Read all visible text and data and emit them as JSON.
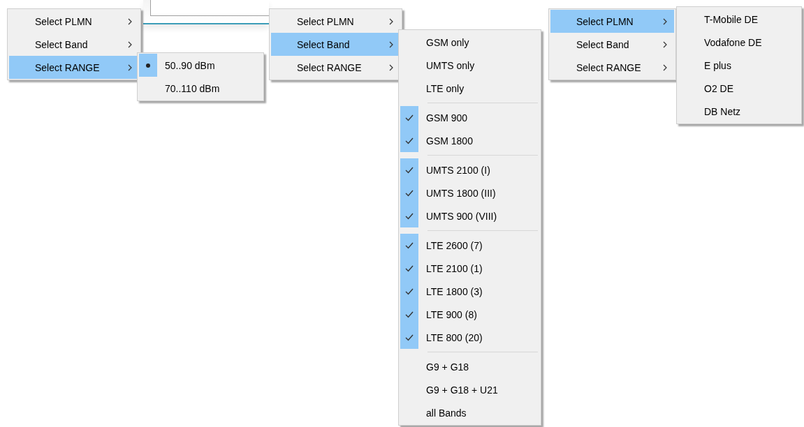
{
  "menus": [
    {
      "items": [
        {
          "label": "Select PLMN",
          "selected": false
        },
        {
          "label": "Select Band",
          "selected": false
        },
        {
          "label": "Select RANGE",
          "selected": true
        }
      ],
      "submenu": {
        "items": [
          {
            "kind": "radio",
            "label": "50..90 dBm",
            "checked": true
          },
          {
            "kind": "radio",
            "label": "70..110 dBm",
            "checked": false
          }
        ]
      }
    },
    {
      "items": [
        {
          "label": "Select PLMN",
          "selected": false
        },
        {
          "label": "Select Band",
          "selected": true
        },
        {
          "label": "Select RANGE",
          "selected": false
        }
      ],
      "submenu": {
        "items": [
          {
            "kind": "plain",
            "label": "GSM only"
          },
          {
            "kind": "plain",
            "label": "UMTS only"
          },
          {
            "kind": "plain",
            "label": "LTE only"
          },
          {
            "kind": "separator"
          },
          {
            "kind": "check",
            "label": "GSM 900",
            "checked": true
          },
          {
            "kind": "check",
            "label": "GSM 1800",
            "checked": true
          },
          {
            "kind": "separator"
          },
          {
            "kind": "check",
            "label": "UMTS 2100 (I)",
            "checked": true
          },
          {
            "kind": "check",
            "label": "UMTS 1800 (III)",
            "checked": true
          },
          {
            "kind": "check",
            "label": "UMTS 900 (VIII)",
            "checked": true
          },
          {
            "kind": "separator"
          },
          {
            "kind": "check",
            "label": "LTE 2600 (7)",
            "checked": true
          },
          {
            "kind": "check",
            "label": "LTE 2100 (1)",
            "checked": true
          },
          {
            "kind": "check",
            "label": "LTE 1800 (3)",
            "checked": true
          },
          {
            "kind": "check",
            "label": "LTE 900 (8)",
            "checked": true
          },
          {
            "kind": "check",
            "label": "LTE 800 (20)",
            "checked": true
          },
          {
            "kind": "separator"
          },
          {
            "kind": "plain",
            "label": "G9 + G18"
          },
          {
            "kind": "plain",
            "label": "G9 + G18 + U21"
          },
          {
            "kind": "plain",
            "label": "all Bands"
          }
        ]
      }
    },
    {
      "items": [
        {
          "label": "Select PLMN",
          "selected": true
        },
        {
          "label": "Select Band",
          "selected": false
        },
        {
          "label": "Select RANGE",
          "selected": false
        }
      ],
      "submenu": {
        "items": [
          {
            "kind": "plain",
            "label": "T-Mobile DE"
          },
          {
            "kind": "plain",
            "label": "Vodafone DE"
          },
          {
            "kind": "plain",
            "label": "E plus"
          },
          {
            "kind": "plain",
            "label": "O2 DE"
          },
          {
            "kind": "plain",
            "label": "DB Netz"
          }
        ]
      }
    }
  ]
}
